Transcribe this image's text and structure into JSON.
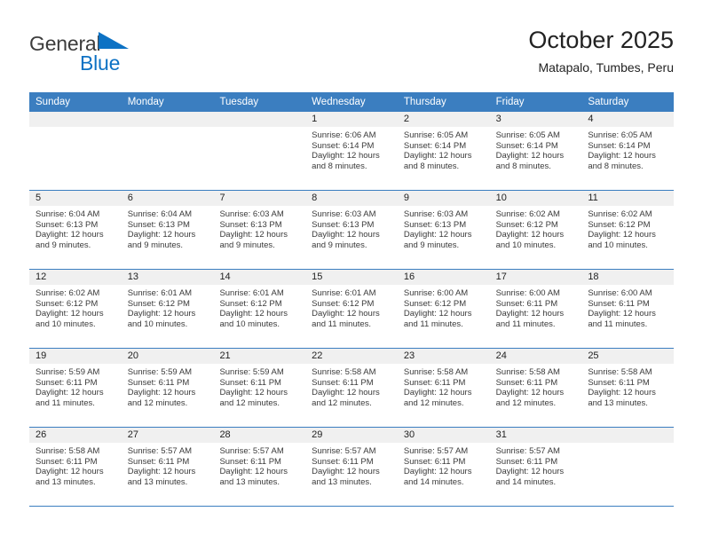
{
  "brand": {
    "name_part1": "General",
    "name_part2": "Blue",
    "flag_icon": "blue-triangle-flag",
    "accent_color": "#0d72c4"
  },
  "header": {
    "title": "October 2025",
    "subtitle": "Matapalo, Tumbes, Peru"
  },
  "calendar": {
    "header_bg_color": "#3b7ec0",
    "day_band_color": "#f0f0f0",
    "weekdays": [
      "Sunday",
      "Monday",
      "Tuesday",
      "Wednesday",
      "Thursday",
      "Friday",
      "Saturday"
    ],
    "weeks": [
      [
        {
          "day": "",
          "lines": []
        },
        {
          "day": "",
          "lines": []
        },
        {
          "day": "",
          "lines": []
        },
        {
          "day": "1",
          "lines": [
            "Sunrise: 6:06 AM",
            "Sunset: 6:14 PM",
            "Daylight: 12 hours",
            "and 8 minutes."
          ]
        },
        {
          "day": "2",
          "lines": [
            "Sunrise: 6:05 AM",
            "Sunset: 6:14 PM",
            "Daylight: 12 hours",
            "and 8 minutes."
          ]
        },
        {
          "day": "3",
          "lines": [
            "Sunrise: 6:05 AM",
            "Sunset: 6:14 PM",
            "Daylight: 12 hours",
            "and 8 minutes."
          ]
        },
        {
          "day": "4",
          "lines": [
            "Sunrise: 6:05 AM",
            "Sunset: 6:14 PM",
            "Daylight: 12 hours",
            "and 8 minutes."
          ]
        }
      ],
      [
        {
          "day": "5",
          "lines": [
            "Sunrise: 6:04 AM",
            "Sunset: 6:13 PM",
            "Daylight: 12 hours",
            "and 9 minutes."
          ]
        },
        {
          "day": "6",
          "lines": [
            "Sunrise: 6:04 AM",
            "Sunset: 6:13 PM",
            "Daylight: 12 hours",
            "and 9 minutes."
          ]
        },
        {
          "day": "7",
          "lines": [
            "Sunrise: 6:03 AM",
            "Sunset: 6:13 PM",
            "Daylight: 12 hours",
            "and 9 minutes."
          ]
        },
        {
          "day": "8",
          "lines": [
            "Sunrise: 6:03 AM",
            "Sunset: 6:13 PM",
            "Daylight: 12 hours",
            "and 9 minutes."
          ]
        },
        {
          "day": "9",
          "lines": [
            "Sunrise: 6:03 AM",
            "Sunset: 6:13 PM",
            "Daylight: 12 hours",
            "and 9 minutes."
          ]
        },
        {
          "day": "10",
          "lines": [
            "Sunrise: 6:02 AM",
            "Sunset: 6:12 PM",
            "Daylight: 12 hours",
            "and 10 minutes."
          ]
        },
        {
          "day": "11",
          "lines": [
            "Sunrise: 6:02 AM",
            "Sunset: 6:12 PM",
            "Daylight: 12 hours",
            "and 10 minutes."
          ]
        }
      ],
      [
        {
          "day": "12",
          "lines": [
            "Sunrise: 6:02 AM",
            "Sunset: 6:12 PM",
            "Daylight: 12 hours",
            "and 10 minutes."
          ]
        },
        {
          "day": "13",
          "lines": [
            "Sunrise: 6:01 AM",
            "Sunset: 6:12 PM",
            "Daylight: 12 hours",
            "and 10 minutes."
          ]
        },
        {
          "day": "14",
          "lines": [
            "Sunrise: 6:01 AM",
            "Sunset: 6:12 PM",
            "Daylight: 12 hours",
            "and 10 minutes."
          ]
        },
        {
          "day": "15",
          "lines": [
            "Sunrise: 6:01 AM",
            "Sunset: 6:12 PM",
            "Daylight: 12 hours",
            "and 11 minutes."
          ]
        },
        {
          "day": "16",
          "lines": [
            "Sunrise: 6:00 AM",
            "Sunset: 6:12 PM",
            "Daylight: 12 hours",
            "and 11 minutes."
          ]
        },
        {
          "day": "17",
          "lines": [
            "Sunrise: 6:00 AM",
            "Sunset: 6:11 PM",
            "Daylight: 12 hours",
            "and 11 minutes."
          ]
        },
        {
          "day": "18",
          "lines": [
            "Sunrise: 6:00 AM",
            "Sunset: 6:11 PM",
            "Daylight: 12 hours",
            "and 11 minutes."
          ]
        }
      ],
      [
        {
          "day": "19",
          "lines": [
            "Sunrise: 5:59 AM",
            "Sunset: 6:11 PM",
            "Daylight: 12 hours",
            "and 11 minutes."
          ]
        },
        {
          "day": "20",
          "lines": [
            "Sunrise: 5:59 AM",
            "Sunset: 6:11 PM",
            "Daylight: 12 hours",
            "and 12 minutes."
          ]
        },
        {
          "day": "21",
          "lines": [
            "Sunrise: 5:59 AM",
            "Sunset: 6:11 PM",
            "Daylight: 12 hours",
            "and 12 minutes."
          ]
        },
        {
          "day": "22",
          "lines": [
            "Sunrise: 5:58 AM",
            "Sunset: 6:11 PM",
            "Daylight: 12 hours",
            "and 12 minutes."
          ]
        },
        {
          "day": "23",
          "lines": [
            "Sunrise: 5:58 AM",
            "Sunset: 6:11 PM",
            "Daylight: 12 hours",
            "and 12 minutes."
          ]
        },
        {
          "day": "24",
          "lines": [
            "Sunrise: 5:58 AM",
            "Sunset: 6:11 PM",
            "Daylight: 12 hours",
            "and 12 minutes."
          ]
        },
        {
          "day": "25",
          "lines": [
            "Sunrise: 5:58 AM",
            "Sunset: 6:11 PM",
            "Daylight: 12 hours",
            "and 13 minutes."
          ]
        }
      ],
      [
        {
          "day": "26",
          "lines": [
            "Sunrise: 5:58 AM",
            "Sunset: 6:11 PM",
            "Daylight: 12 hours",
            "and 13 minutes."
          ]
        },
        {
          "day": "27",
          "lines": [
            "Sunrise: 5:57 AM",
            "Sunset: 6:11 PM",
            "Daylight: 12 hours",
            "and 13 minutes."
          ]
        },
        {
          "day": "28",
          "lines": [
            "Sunrise: 5:57 AM",
            "Sunset: 6:11 PM",
            "Daylight: 12 hours",
            "and 13 minutes."
          ]
        },
        {
          "day": "29",
          "lines": [
            "Sunrise: 5:57 AM",
            "Sunset: 6:11 PM",
            "Daylight: 12 hours",
            "and 13 minutes."
          ]
        },
        {
          "day": "30",
          "lines": [
            "Sunrise: 5:57 AM",
            "Sunset: 6:11 PM",
            "Daylight: 12 hours",
            "and 14 minutes."
          ]
        },
        {
          "day": "31",
          "lines": [
            "Sunrise: 5:57 AM",
            "Sunset: 6:11 PM",
            "Daylight: 12 hours",
            "and 14 minutes."
          ]
        },
        {
          "day": "",
          "lines": []
        }
      ]
    ]
  }
}
